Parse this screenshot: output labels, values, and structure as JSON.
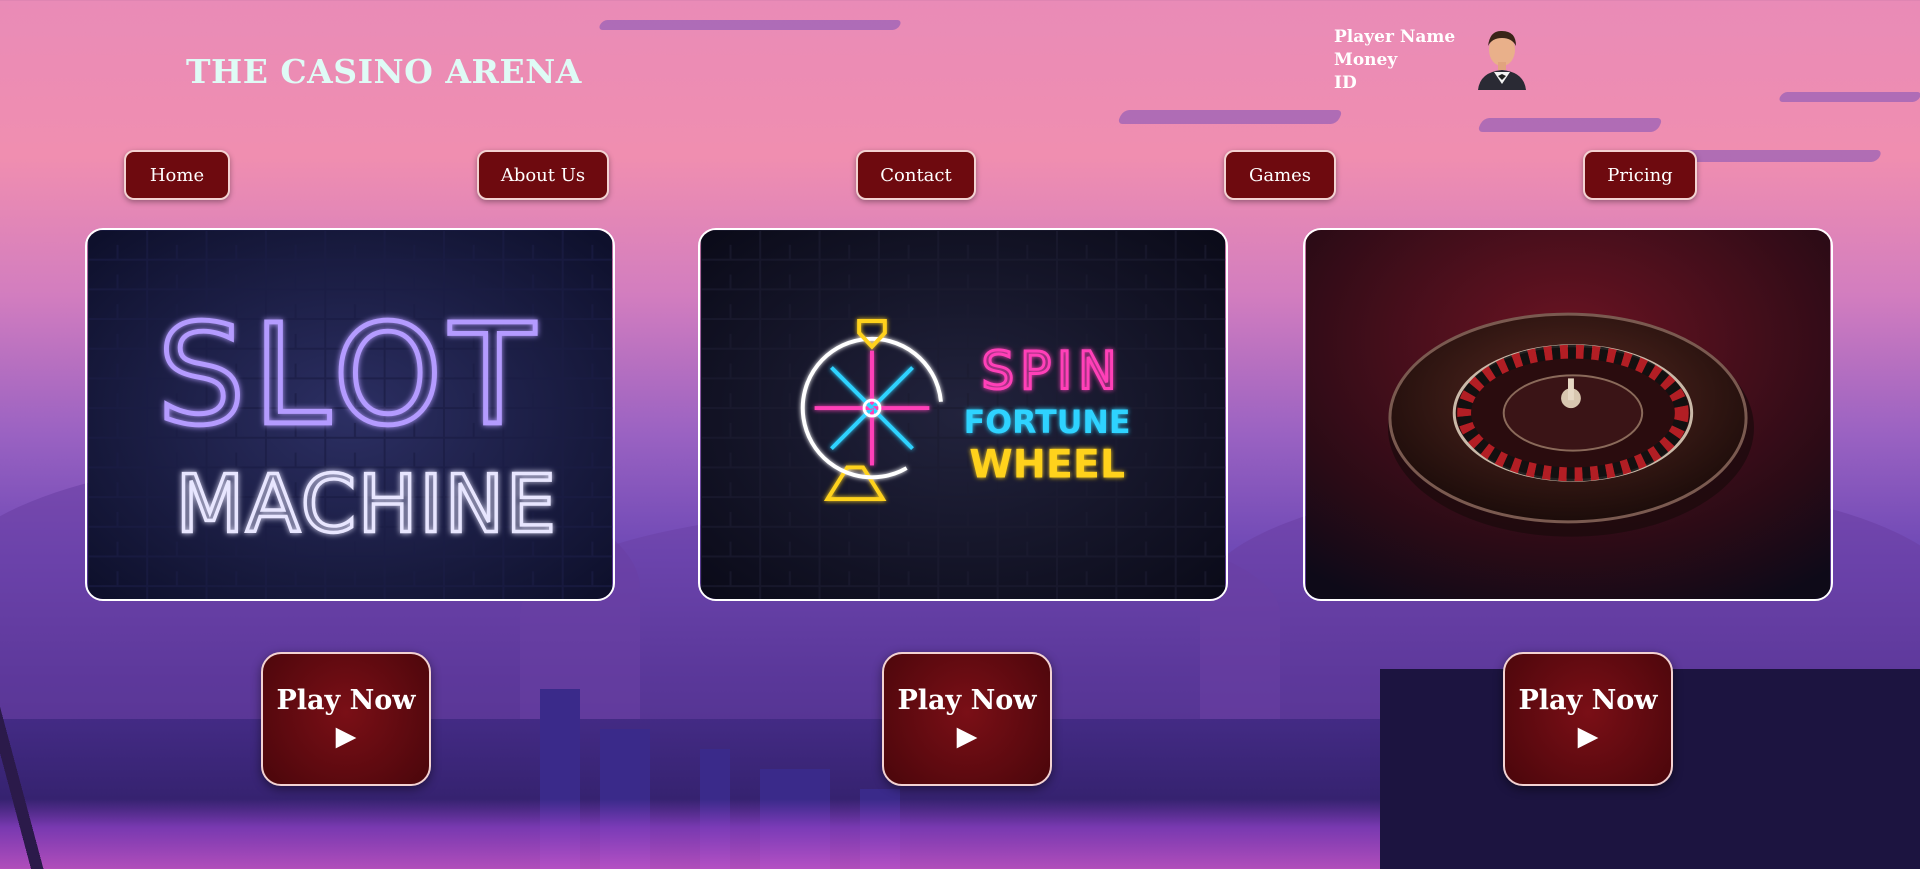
{
  "header": {
    "title": "THE CASINO ARENA",
    "player": {
      "name_label": "Player Name",
      "money_label": "Money",
      "id_label": "ID"
    }
  },
  "nav": {
    "items": [
      {
        "label": "Home"
      },
      {
        "label": "About Us"
      },
      {
        "label": "Contact"
      },
      {
        "label": "Games"
      },
      {
        "label": "Pricing"
      }
    ]
  },
  "games": [
    {
      "name": "slot-machine",
      "line1": "SLOT",
      "line2": "MACHINE",
      "play_label": "Play Now",
      "play_icon": "▶"
    },
    {
      "name": "spin-fortune-wheel",
      "line1": "SPIN",
      "line2": "FORTUNE",
      "line3": "WHEEL",
      "play_label": "Play Now",
      "play_icon": "▶"
    },
    {
      "name": "roulette",
      "play_label": "Play Now",
      "play_icon": "▶"
    }
  ],
  "colors": {
    "accent": "#6e0a0f",
    "title": "#dffbf6",
    "neon_purple": "#9c7bff",
    "neon_pink": "#ff3fb8",
    "neon_cyan": "#2fd3ff",
    "neon_yellow": "#ffd21f"
  },
  "icons": {
    "avatar": "user-avatar-icon",
    "play": "play-triangle-icon"
  }
}
